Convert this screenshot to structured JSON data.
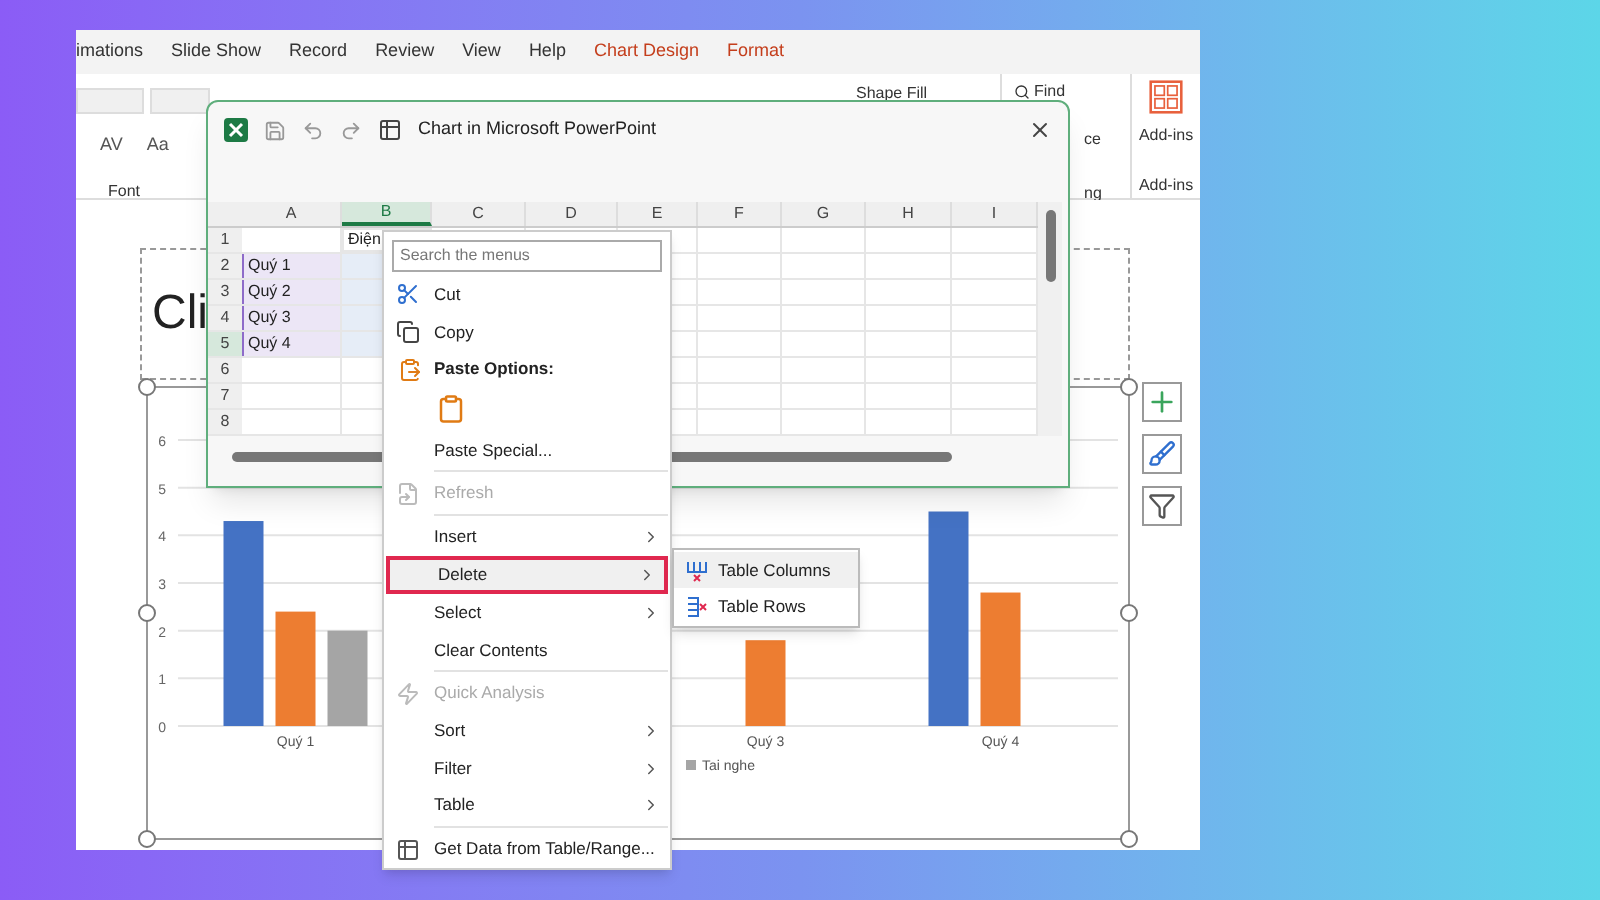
{
  "ribbon": {
    "tabs": [
      {
        "label": "imations"
      },
      {
        "label": "Slide Show"
      },
      {
        "label": "Record"
      },
      {
        "label": "Review"
      },
      {
        "label": "View"
      },
      {
        "label": "Help"
      },
      {
        "label": "Chart Design",
        "color": "#c43e1c"
      },
      {
        "label": "Format",
        "color": "#c43e1c"
      }
    ],
    "font_buttons": [
      "AV",
      "Aa"
    ],
    "font_group": "Font",
    "shape_fill": "Shape Fill",
    "find": "Find",
    "fragments": [
      "ce",
      "ng"
    ],
    "addins_button": "Add-ins",
    "addins_group": "Add-ins"
  },
  "slide": {
    "title_placeholder": "Cli",
    "chart": {
      "chart_data": {
        "type": "bar",
        "categories": [
          "Quý 1",
          null,
          "Quý 3",
          "Quý 4"
        ],
        "ylim": [
          0,
          6
        ],
        "grid": true,
        "yticks": [
          0,
          1,
          2,
          3,
          4,
          5,
          6
        ],
        "series": [
          {
            "color": "#4472c4",
            "values": [
              4.3,
              null,
              null,
              4.5
            ]
          },
          {
            "color": "#ed7d31",
            "values": [
              2.4,
              null,
              1.8,
              2.8
            ]
          },
          {
            "name": "Tai nghe",
            "color": "#a5a5a5",
            "values": [
              2.0,
              null,
              null,
              null
            ]
          }
        ]
      }
    }
  },
  "excel_window": {
    "title": "Chart in Microsoft PowerPoint",
    "columns": [
      {
        "label": "A",
        "selected": false
      },
      {
        "label": "B",
        "selected": true
      },
      {
        "label": "C",
        "selected": false
      },
      {
        "label": "D",
        "selected": false
      },
      {
        "label": "E",
        "selected": false
      },
      {
        "label": "F",
        "selected": false
      },
      {
        "label": "G",
        "selected": false
      },
      {
        "label": "H",
        "selected": false
      },
      {
        "label": "I",
        "selected": false
      }
    ],
    "rows": [
      {
        "label": "1",
        "b": "Điện",
        "in_range": false,
        "selected": false
      },
      {
        "label": "2",
        "a": "Quý 1",
        "in_range": true,
        "selected": false
      },
      {
        "label": "3",
        "a": "Quý 2",
        "in_range": true,
        "selected": false
      },
      {
        "label": "4",
        "a": "Quý 3",
        "in_range": true,
        "selected": false
      },
      {
        "label": "5",
        "a": "Quý 4",
        "in_range": true,
        "selected": true
      },
      {
        "label": "6",
        "in_range": false,
        "selected": false
      },
      {
        "label": "7",
        "in_range": false,
        "selected": false
      },
      {
        "label": "8",
        "in_range": false,
        "selected": false
      }
    ]
  },
  "context_menu": {
    "search_placeholder": "Search the menus",
    "items": [
      {
        "kind": "item",
        "label": "Cut",
        "disabled": false,
        "has_submenu": false,
        "selected": false
      },
      {
        "kind": "item",
        "label": "Copy",
        "disabled": false,
        "has_submenu": false,
        "selected": false
      },
      {
        "kind": "header",
        "label": "Paste Options:"
      },
      {
        "kind": "paste_button"
      },
      {
        "kind": "item",
        "label": "Paste Special...",
        "disabled": false,
        "has_submenu": false,
        "selected": false
      },
      {
        "kind": "separator"
      },
      {
        "kind": "item",
        "label": "Refresh",
        "disabled": true,
        "has_submenu": false,
        "selected": false
      },
      {
        "kind": "separator"
      },
      {
        "kind": "item",
        "label": "Insert",
        "disabled": false,
        "has_submenu": true,
        "selected": false
      },
      {
        "kind": "item",
        "label": "Delete",
        "disabled": false,
        "has_submenu": true,
        "selected": true
      },
      {
        "kind": "item",
        "label": "Select",
        "disabled": false,
        "has_submenu": true,
        "selected": false
      },
      {
        "kind": "item",
        "label": "Clear Contents",
        "disabled": false,
        "has_submenu": false,
        "selected": false
      },
      {
        "kind": "separator"
      },
      {
        "kind": "item",
        "label": "Quick Analysis",
        "disabled": true,
        "has_submenu": false,
        "selected": false
      },
      {
        "kind": "item",
        "label": "Sort",
        "disabled": false,
        "has_submenu": true,
        "selected": false
      },
      {
        "kind": "item",
        "label": "Filter",
        "disabled": false,
        "has_submenu": true,
        "selected": false
      },
      {
        "kind": "item",
        "label": "Table",
        "disabled": false,
        "has_submenu": true,
        "selected": false
      },
      {
        "kind": "separator"
      },
      {
        "kind": "item",
        "label": "Get Data from Table/Range...",
        "disabled": false,
        "has_submenu": false,
        "selected": false
      }
    ]
  },
  "submenu": {
    "items": [
      {
        "label": "Table Columns",
        "selected": true
      },
      {
        "label": "Table Rows",
        "selected": false
      }
    ]
  }
}
